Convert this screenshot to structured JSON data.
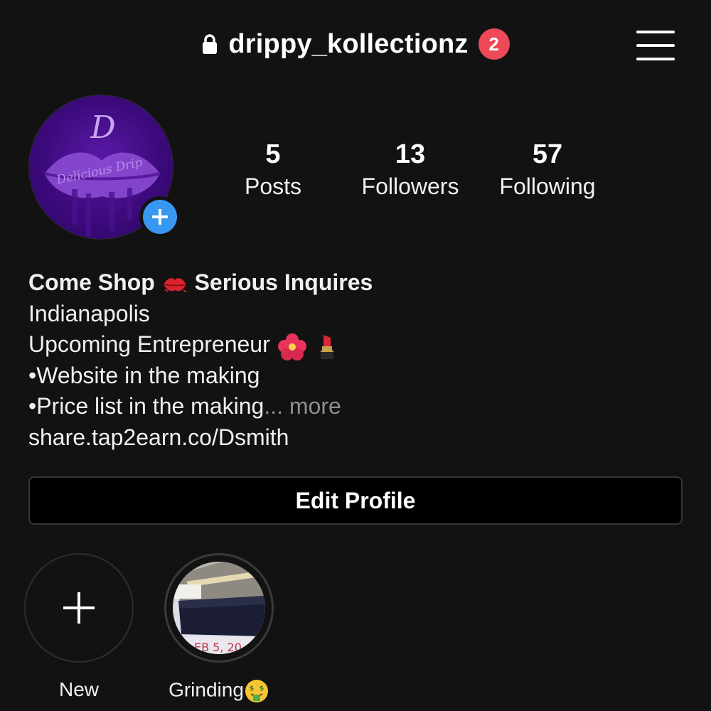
{
  "header": {
    "username": "drippy_kollectionz",
    "notification_count": "2",
    "lock_icon": "lock-icon",
    "menu_icon": "hamburger-menu-icon"
  },
  "profile": {
    "avatar_logo_letter": "D",
    "avatar_logo_text": "Delicious Drip",
    "add_story_icon": "plus-icon"
  },
  "stats": [
    {
      "value": "5",
      "label": "Posts"
    },
    {
      "value": "13",
      "label": "Followers"
    },
    {
      "value": "57",
      "label": "Following"
    }
  ],
  "bio": {
    "name": "Come Shop",
    "name_suffix": "Serious Inquires",
    "lines": [
      "Indianapolis",
      "Upcoming Entrepreneur",
      "•Website in the making",
      "•Price list in the making"
    ],
    "ellipsis": "...",
    "more_label": "more",
    "link": "share.tap2earn.co/Dsmith"
  },
  "edit_profile_label": "Edit Profile",
  "highlights": [
    {
      "label": "New",
      "icon": "plus-icon"
    },
    {
      "label": "Grinding",
      "thumbnail_text": "EB 5, 20"
    }
  ],
  "colors": {
    "background": "#121212",
    "badge_red": "#ed4956",
    "add_blue": "#3897f0",
    "link": "#e0f1ff",
    "muted": "#8e8e8e"
  }
}
